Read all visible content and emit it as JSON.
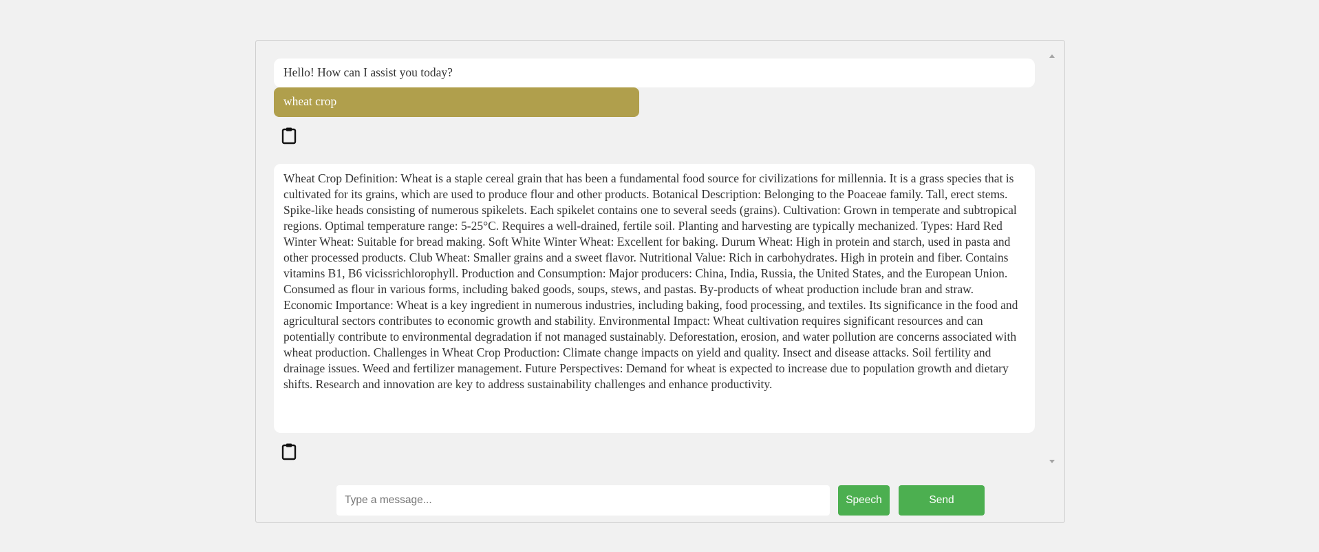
{
  "chat": {
    "messages": [
      {
        "role": "bot",
        "text": "Hello! How can I assist you today?"
      },
      {
        "role": "user",
        "text": "wheat crop"
      },
      {
        "role": "bot",
        "text": "Wheat Crop Definition: Wheat is a staple cereal grain that has been a fundamental food source for civilizations for millennia. It is a grass species that is cultivated for its grains, which are used to produce flour and other products. Botanical Description: Belonging to the Poaceae family. Tall, erect stems. Spike-like heads consisting of numerous spikelets. Each spikelet contains one to several seeds (grains). Cultivation: Grown in temperate and subtropical regions. Optimal temperature range: 5-25°C. Requires a well-drained, fertile soil. Planting and harvesting are typically mechanized. Types: Hard Red Winter Wheat: Suitable for bread making. Soft White Winter Wheat: Excellent for baking. Durum Wheat: High in protein and starch, used in pasta and other processed products. Club Wheat: Smaller grains and a sweet flavor. Nutritional Value: Rich in carbohydrates. High in protein and fiber. Contains vitamins B1, B6 vicissrichlorophyll. Production and Consumption: Major producers: China, India, Russia, the United States, and the European Union. Consumed as flour in various forms, including baked goods, soups, stews, and pastas. By-products of wheat production include bran and straw. Economic Importance: Wheat is a key ingredient in numerous industries, including baking, food processing, and textiles. Its significance in the food and agricultural sectors contributes to economic growth and stability. Environmental Impact: Wheat cultivation requires significant resources and can potentially contribute to environmental degradation if not managed sustainably. Deforestation, erosion, and water pollution are concerns associated with wheat production. Challenges in Wheat Crop Production: Climate change impacts on yield and quality. Insect and disease attacks. Soil fertility and drainage issues. Weed and fertilizer management. Future Perspectives: Demand for wheat is expected to increase due to population growth and dietary shifts. Research and innovation are key to address sustainability challenges and enhance productivity."
      }
    ],
    "icons": {
      "copy": "clipboard-icon"
    }
  },
  "input": {
    "placeholder": "Type a message...",
    "value": ""
  },
  "buttons": {
    "speech_label": "Speech",
    "send_label": "Send"
  },
  "colors": {
    "user_bubble": "#b09f4c",
    "bot_bubble": "#ffffff",
    "button": "#4caf50",
    "background": "#f1f1f1"
  }
}
